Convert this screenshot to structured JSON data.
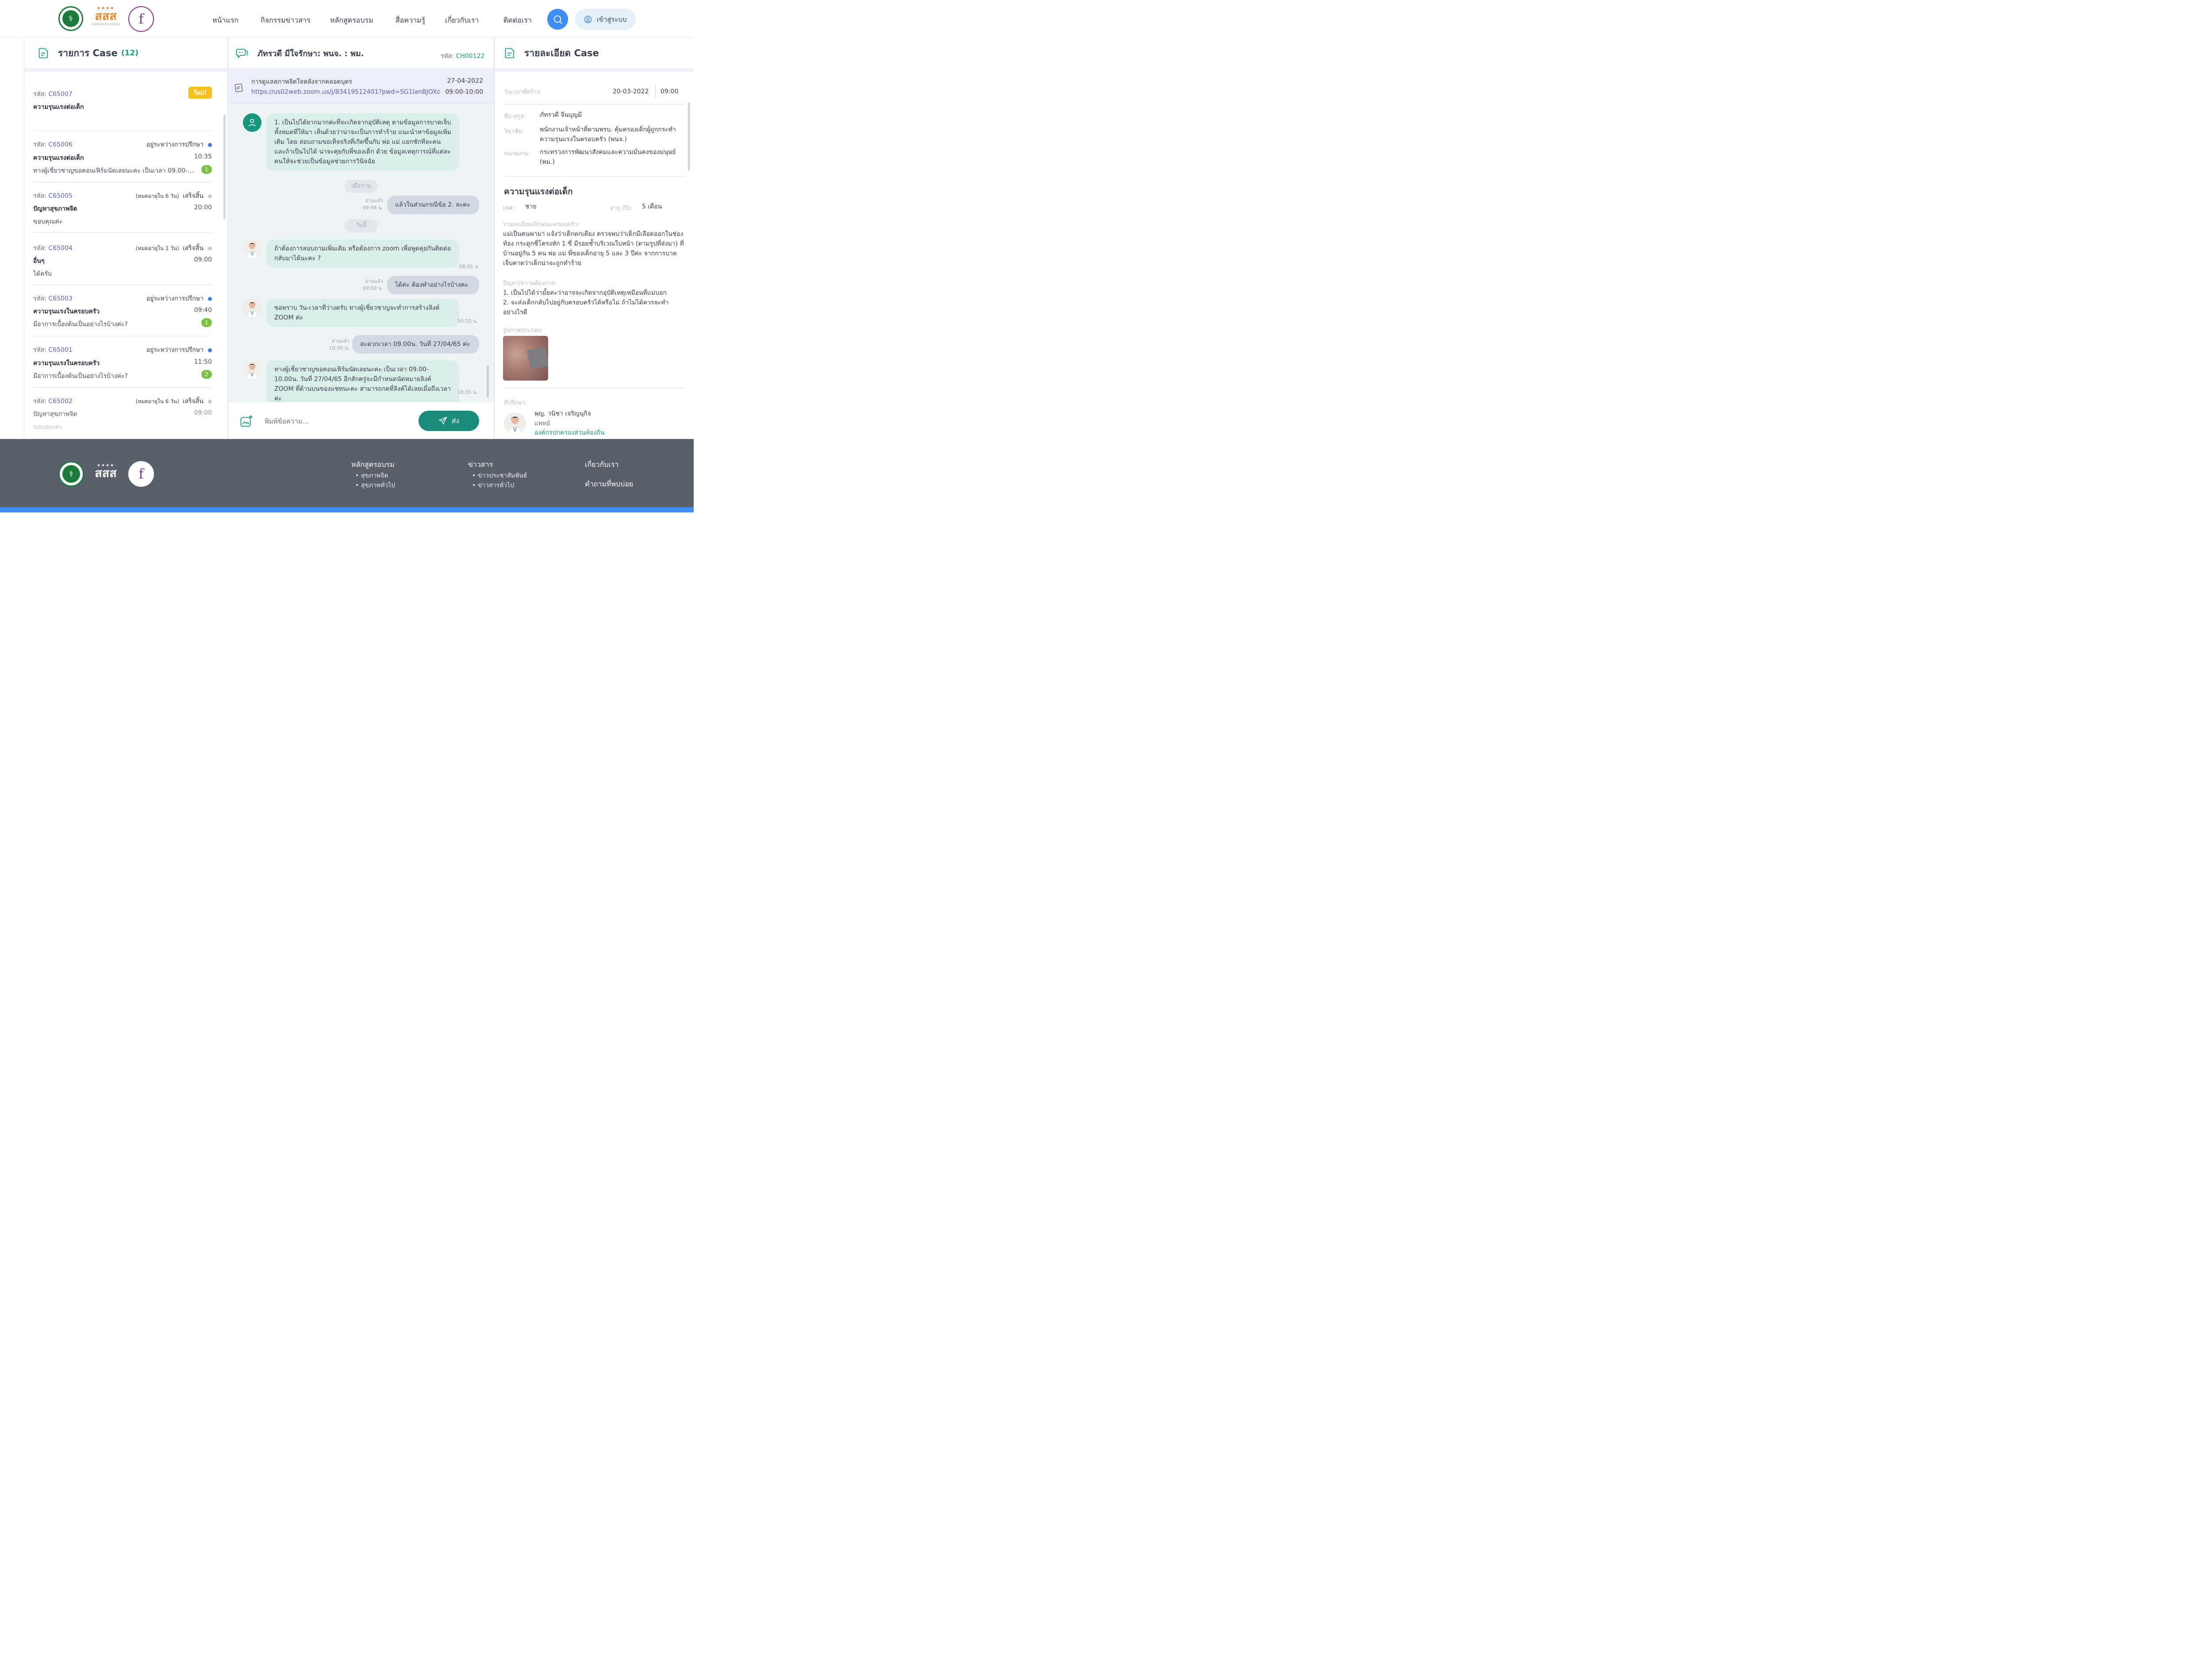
{
  "header": {
    "nav": [
      "หน้าแรก",
      "กิจกรรมข่าวสาร",
      "หลักสูตรอบรม",
      "สื่อความรู้",
      "เกี่ยวกับเรา",
      "ติดต่อเรา"
    ],
    "login_label": "เข้าสู่ระบบ",
    "logo_sss_text": "สสส"
  },
  "case_list": {
    "title": "รายการ Case",
    "count": "(12)",
    "code_prefix": "รหัส:",
    "items": [
      {
        "code": "C65007",
        "category": "ความรุนแรงต่อเด็ก",
        "badge": "ใหม่!"
      },
      {
        "code": "C65006",
        "category": "ความรุนแรงต่อเด็ก",
        "status": "อยู่ระหว่างการปรึกษา",
        "time": "10:35",
        "message": "ทางผู้เชี่ยวชาญขอคอนเฟิร์มนัดเลยนะคะ เป็นเวลา 09.00-.....",
        "unread": "1"
      },
      {
        "code": "C65005",
        "expiry": "(หมดอายุใน 6 วัน)",
        "status": "เสร็จสิ้น",
        "category": "ปัญหาสุขภาพจิต",
        "time": "20:00",
        "message": "ขอบคุณค่ะ"
      },
      {
        "code": "C65004",
        "expiry": "(หมดอายุใน 1 วัน)",
        "status": "เสร็จสิ้น",
        "category": "อื่นๆ",
        "time": "09:00",
        "message": "ได้ครับ"
      },
      {
        "code": "C65003",
        "status": "อยู่ระหว่างการปรึกษา",
        "category": "ความรุนแรงในครอบครัว",
        "time": "09:40",
        "message": "มีอาการเบื้องต้นเป็นอย่างไรบ้างค่ะ?",
        "unread": "1"
      },
      {
        "code": "C65001",
        "status": "อยู่ระหว่างการปรึกษา",
        "category": "ความรุนแรงในครอบครัว",
        "time": "11:50",
        "message": "มีอาการเบื้องต้นเป็นอย่างไรบ้างค่ะ?",
        "unread": "2"
      },
      {
        "code": "C65002",
        "expiry": "(หมดอายุใน 6 วัน)",
        "status": "เสร็จสิ้น",
        "category": "ปัญหาสุขภาพจิต",
        "time": "09:00",
        "message": "ขอบคุณค่ะ"
      }
    ]
  },
  "chat": {
    "title": "ภัทรวดี มีใจรักษา: พนจ. : พม.",
    "code_label": "รหัส:",
    "code": "CH00122",
    "meeting": {
      "topic": "การดูแลสภาพจิตใจหลังจากคลอดบุตร",
      "link": "https://us02web.zoom.us/j/83419512401?pwd=SG1lanBJOXd...",
      "date": "27-04-2022",
      "time": "09:00-10:00"
    },
    "messages": [
      {
        "text": "1. เป็นไปได้ยากมากค่ะที่จะเกิดจากอุบัติเหตุ ตามข้อมูลการบาดเจ็บทั้งหมดที่ให้มา เห็นด้วยว่าน่าจะเป็นการทำร้าย แนะนำหาข้อมูลเพิ่มเติม โดย สอบถามขอเท็จจริงที่เกิดขึ้นกับ พ่อ แม่ แยกซักทีละคน และถ้าเป็นไปได้ น่าจะคุยกับพี่ของเด็ก ด้วย ข้อมูลเหตุการณ์ที่แต่ละคนให้จะช่วยเป็นข้อมูลช่วยการวินิจฉัย"
      },
      {
        "day": "เมื่อวาน"
      },
      {
        "read": "อ่านแล้ว",
        "time": "09:58 น.",
        "text": "แล้วในส่วนกรณีข้อ 2. ละคะ"
      },
      {
        "day": "วันนี้"
      },
      {
        "text": "ถ้าต้องการสอบถามเพิ่มเติม หรือต้องการ zoom เพื่อพูดคุยกันติดต่อกลับมาได้นะคะ ?",
        "time": "08:55 น."
      },
      {
        "read": "อ่านแล้ว",
        "time": "09:50 น.",
        "text": "ได้ค่ะ ต้องทำอย่างไรบ้างคะ"
      },
      {
        "text": "ขอทราบ วัน-เวลาที่ว่างครับ ทางผู้เชี่ยวชาญจะทำการสร้างลิงค์ ZOOM ค่ะ",
        "time": "10:10 น."
      },
      {
        "read": "อ่านแล้ว",
        "time": "10:30 น.",
        "text": "สะดวกเวลา 09.00น. วันที่ 27/04/65 ค่ะ"
      },
      {
        "text": "ทางผู้เชี่ยวชาญขอคอนเฟิร์มนัดเลยนะคะ เป็นเวลา 09.00-10.00น. วันที่ 27/04/65 อีกสักครู่จะมีกำหนดนัดหมายลิงค์ ZOOM ที่ด้านบนของแชทนะคะ สามารถกดที่ลิงค์ได้เลยเมื่อถึงเวลาค่ะ",
        "time": "10:35 น."
      }
    ],
    "input_placeholder": "พิมพ์ข้อความ...",
    "send_label": "ส่ง"
  },
  "detail": {
    "title": "รายละเอียด Case",
    "created_label": "วันเวลาที่สร้าง:",
    "created_date": "20-03-2022",
    "created_time": "09:00",
    "name_label": "ชื่อ-สกุล:",
    "name": "ภัทรวดี จีนบุญมี",
    "job_label": "วิชาชีพ:",
    "job": "พนักงานเจ้าหน้าที่ตามพรบ. คุ้มครองเด็กผู้ถูกกระทำความรุนแรงในครอบครัว (พนจ.)",
    "org_label": "หน่วยงาน:",
    "org": "กระทรวงการพัฒนาสังคมและความมั่นคงของมนุษย์ (พม.)",
    "case_title": "ความรุนแรงต่อเด็ก",
    "sex_label": "เพศ:",
    "sex": "ชาย",
    "age_label": "อายุ (ปี):",
    "age": "5 เดือน",
    "desc_label": "รายละเอียด/ลักษณะครอบครัว:",
    "desc": "แม่เป็นคนพามา แจ้งว่าเด็กตกเตียง ตรวจพบว่าเด็กมีเลือดออกในช่องท้อง กระดูกซี่โครงหัก 1 ซี่ มีรอยช้ำบริเวณใบหน้า (ตามรูปที่ส่งมา) ที่บ้านอยู่กัน 5 คน พ่อ แม่ พี่ของเด็กอายุ 5 และ 3 ปีค่ะ จากการบาดเจ็บคาดว่าเด็กน่าจะถูกทำร้าย",
    "problem_label": "ปัญหา/ความต้องการ:",
    "problem_1": "1. เป็นไปได้ว่ามั้ยคะว่าอาจจะเกิดจากอุบัติเหตุเหมือนที่แม่บอก",
    "problem_2": "2. จะส่งเด็กกลับไปอยู่กับครอบครัวได้หรือไม่ ถ้าไม่ได้ควรจะทำอย่างไรดี",
    "image_label": "รูปภาพประกอบ:",
    "advisor_label": "ที่ปรึกษา:",
    "advisor_name": "พญ. วนิชา เจริญนุกิจ",
    "advisor_role": "แพทย์",
    "advisor_org": "องค์กรปกครองส่วนท้องถิ่น"
  },
  "footer": {
    "col1_title": "หลักสูตรอบรม",
    "col1_links": [
      "สุขภาพจิต",
      "สุขภาพทั่วไป"
    ],
    "col2_title": "ข่าวสาร",
    "col2_links": [
      "ข่าวประชาสัมพันธ์",
      "ข่าวสารทั่วไป"
    ],
    "col3_title": "เกี่ยวกับเรา",
    "col3_link": "คำถามที่พบบ่อย"
  },
  "colors": {
    "primary": "#1a8c7a",
    "accent_blue": "#3e8ef7",
    "new_badge": "#f6c11e",
    "unread": "#7cc242",
    "link": "#5a62c8"
  }
}
